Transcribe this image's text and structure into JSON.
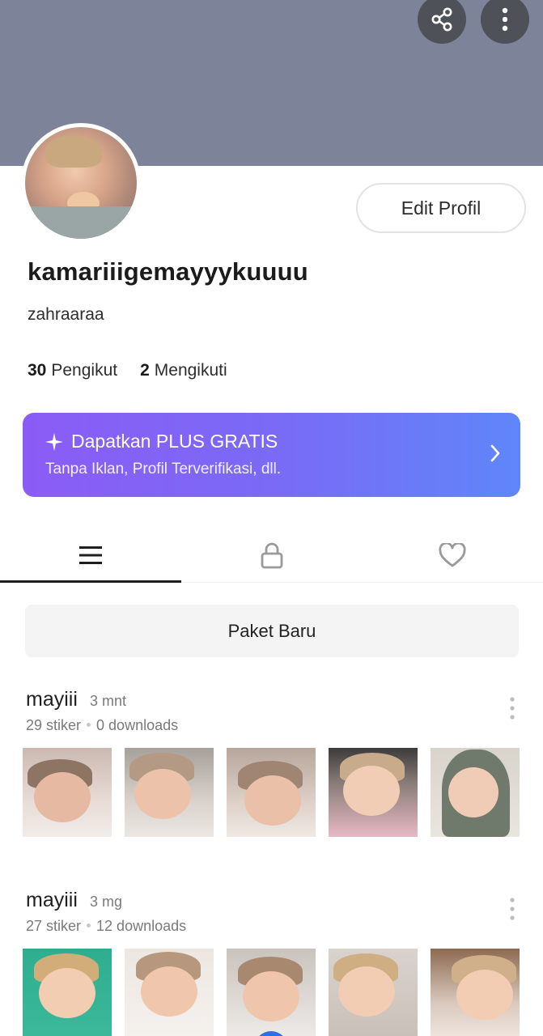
{
  "header": {
    "share_icon": "share-icon",
    "more_icon": "more-vertical-icon",
    "banner_color": "#7d8398"
  },
  "profile": {
    "edit_label": "Edit Profil",
    "username": "kamariiigemayyykuuuu",
    "display_name": "zahraaraa",
    "followers_count": "30",
    "followers_label": "Pengikut",
    "following_count": "2",
    "following_label": "Mengikuti"
  },
  "plus_banner": {
    "title": "Dapatkan PLUS GRATIS",
    "subtitle": "Tanpa Iklan, Profil Terverifikasi, dll.",
    "sparkle_icon": "sparkle-icon",
    "chevron_icon": "chevron-right-icon",
    "gradient_start": "#8b5cf6",
    "gradient_end": "#5f86f9"
  },
  "tabs": [
    {
      "icon": "list-icon",
      "active": true
    },
    {
      "icon": "lock-icon",
      "active": false
    },
    {
      "icon": "heart-icon",
      "active": false
    }
  ],
  "new_pack_label": "Paket Baru",
  "packs": [
    {
      "name": "mayiii",
      "time": "3 mnt",
      "stickers": "29 stiker",
      "downloads": "0 downloads",
      "thumb_count": 5
    },
    {
      "name": "mayiii",
      "time": "3 mg",
      "stickers": "27 stiker",
      "downloads": "12 downloads",
      "thumb_count": 5
    }
  ]
}
